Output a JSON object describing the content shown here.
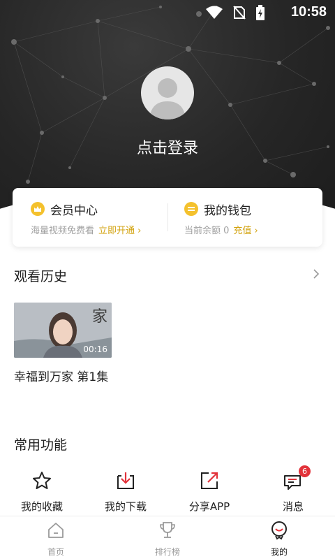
{
  "status_bar": {
    "time": "10:58"
  },
  "profile": {
    "login_label": "点击登录"
  },
  "member_card": {
    "vip": {
      "title": "会员中心",
      "subtitle": "海量视频免费看",
      "action": "立即开通"
    },
    "wallet": {
      "title": "我的钱包",
      "subtitle": "当前余额 0",
      "action": "充值"
    }
  },
  "history": {
    "title": "观看历史",
    "items": [
      {
        "title": "幸福到万家 第1集",
        "duration": "00:16",
        "thumb_glyph": "家"
      }
    ]
  },
  "functions": {
    "title": "常用功能",
    "items": [
      {
        "label": "我的收藏",
        "icon": "star-icon"
      },
      {
        "label": "我的下载",
        "icon": "download-icon"
      },
      {
        "label": "分享APP",
        "icon": "share-icon"
      },
      {
        "label": "消息",
        "icon": "message-icon",
        "badge": "6"
      }
    ]
  },
  "tabbar": {
    "items": [
      {
        "label": "首页",
        "icon": "home-icon"
      },
      {
        "label": "排行榜",
        "icon": "trophy-icon"
      },
      {
        "label": "我的",
        "icon": "profile-icon",
        "active": true
      }
    ]
  },
  "colors": {
    "accent_gold": "#d2a20d",
    "badge_red": "#e2323a",
    "hero_dark": "#262626"
  }
}
